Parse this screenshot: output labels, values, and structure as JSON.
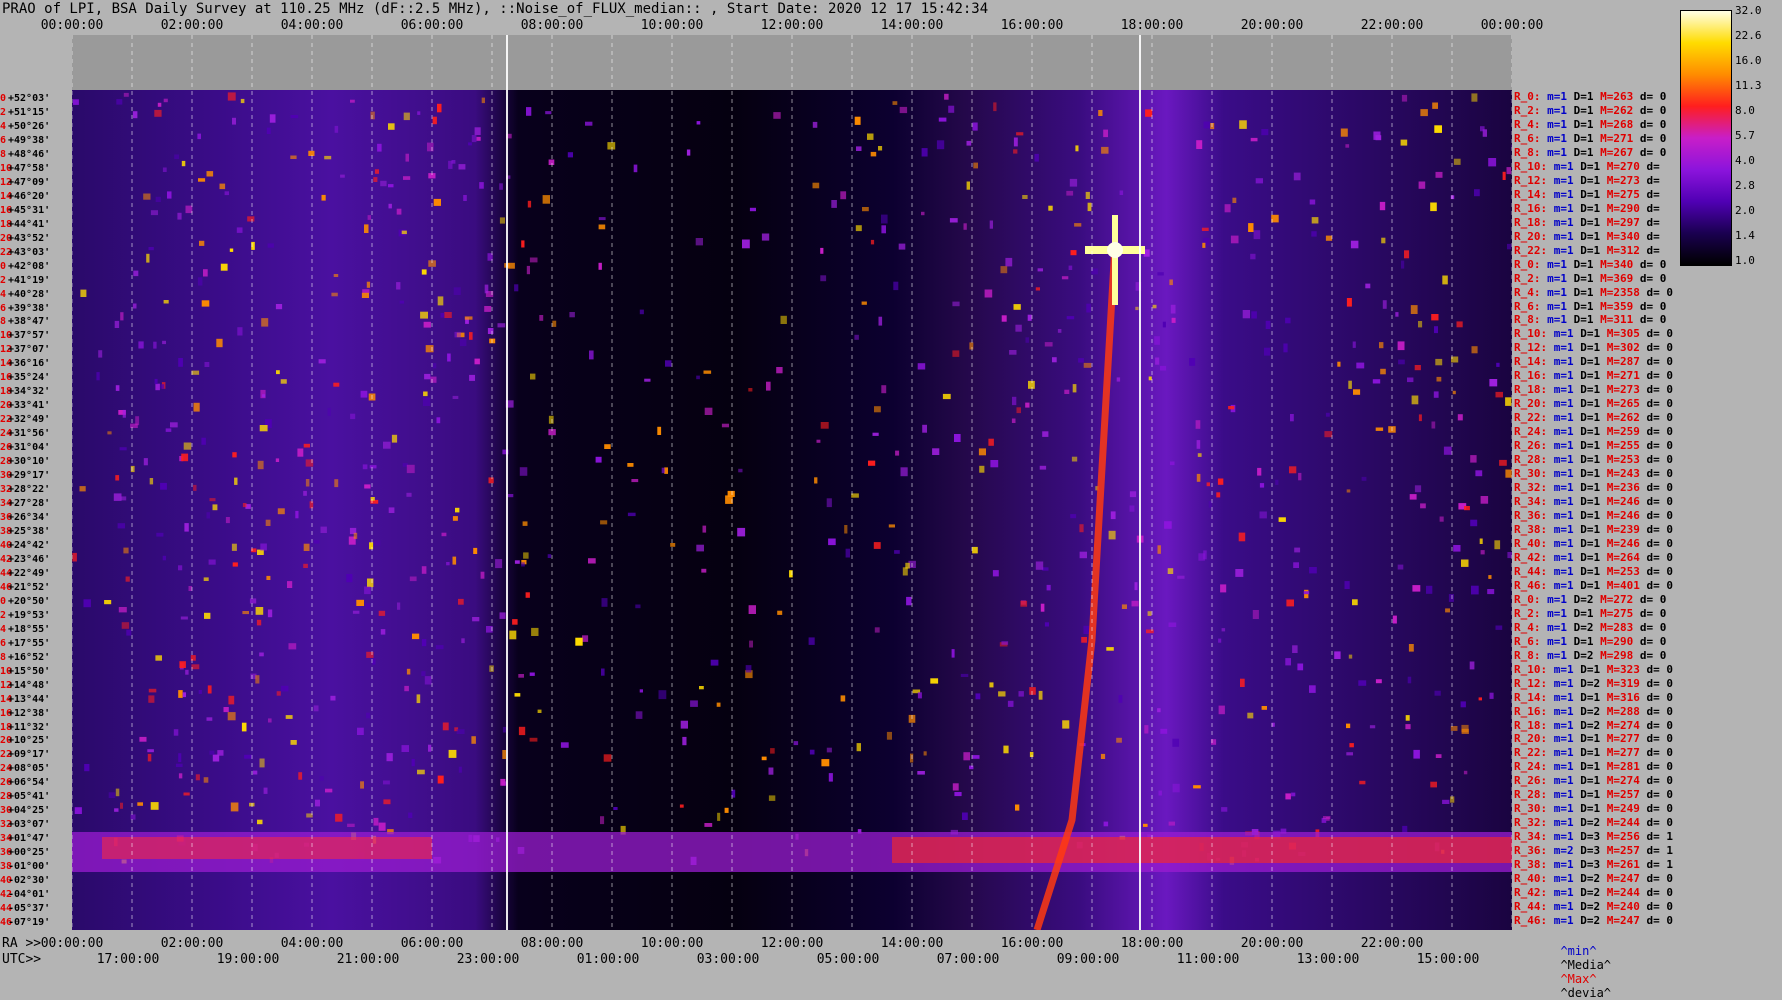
{
  "title": "PRAO of LPI, BSA Daily Survey at 110.25 MHz (dF::2.5 MHz), ::Noise_of_FLUX_median:: , Start Date: 2020 12 17 15:42:34",
  "top_axis": [
    "00:00:00",
    "02:00:00",
    "04:00:00",
    "06:00:00",
    "08:00:00",
    "10:00:00",
    "12:00:00",
    "14:00:00",
    "16:00:00",
    "18:00:00",
    "20:00:00",
    "22:00:00",
    "00:00:00"
  ],
  "ra_axis": {
    "prefix": "RA >>",
    "ticks": [
      "00:00:00",
      "02:00:00",
      "04:00:00",
      "06:00:00",
      "08:00:00",
      "10:00:00",
      "12:00:00",
      "14:00:00",
      "16:00:00",
      "18:00:00",
      "20:00:00",
      "22:00:00"
    ]
  },
  "utc_axis": {
    "prefix": "UTC>>",
    "ticks": [
      "17:00:00",
      "19:00:00",
      "21:00:00",
      "23:00:00",
      "01:00:00",
      "03:00:00",
      "05:00:00",
      "07:00:00",
      "09:00:00",
      "11:00:00",
      "13:00:00",
      "15:00:00"
    ]
  },
  "dec_labels": [
    {
      "i": "0",
      "d": "+52°03'"
    },
    {
      "i": "2",
      "d": "+51°15'"
    },
    {
      "i": "4",
      "d": "+50°26'"
    },
    {
      "i": "6",
      "d": "+49°38'"
    },
    {
      "i": "8",
      "d": "+48°46'"
    },
    {
      "i": "10",
      "d": "+47°58'"
    },
    {
      "i": "12",
      "d": "+47°09'"
    },
    {
      "i": "14",
      "d": "+46°20'"
    },
    {
      "i": "16",
      "d": "+45°31'"
    },
    {
      "i": "18",
      "d": "+44°41'"
    },
    {
      "i": "20",
      "d": "+43°52'"
    },
    {
      "i": "22",
      "d": "+43°03'"
    },
    {
      "i": "0",
      "d": "+42°08'"
    },
    {
      "i": "2",
      "d": "+41°19'"
    },
    {
      "i": "4",
      "d": "+40°28'"
    },
    {
      "i": "6",
      "d": "+39°38'"
    },
    {
      "i": "8",
      "d": "+38°47'"
    },
    {
      "i": "10",
      "d": "+37°57'"
    },
    {
      "i": "12",
      "d": "+37°07'"
    },
    {
      "i": "14",
      "d": "+36°16'"
    },
    {
      "i": "16",
      "d": "+35°24'"
    },
    {
      "i": "18",
      "d": "+34°32'"
    },
    {
      "i": "20",
      "d": "+33°41'"
    },
    {
      "i": "22",
      "d": "+32°49'"
    },
    {
      "i": "24",
      "d": "+31°56'"
    },
    {
      "i": "26",
      "d": "+31°04'"
    },
    {
      "i": "28",
      "d": "+30°10'"
    },
    {
      "i": "30",
      "d": "+29°17'"
    },
    {
      "i": "32",
      "d": "+28°22'"
    },
    {
      "i": "34",
      "d": "+27°28'"
    },
    {
      "i": "36",
      "d": "+26°34'"
    },
    {
      "i": "38",
      "d": "+25°38'"
    },
    {
      "i": "40",
      "d": "+24°42'"
    },
    {
      "i": "42",
      "d": "+23°46'"
    },
    {
      "i": "44",
      "d": "+22°49'"
    },
    {
      "i": "46",
      "d": "+21°52'"
    },
    {
      "i": "0",
      "d": "+20°50'"
    },
    {
      "i": "2",
      "d": "+19°53'"
    },
    {
      "i": "4",
      "d": "+18°55'"
    },
    {
      "i": "6",
      "d": "+17°55'"
    },
    {
      "i": "8",
      "d": "+16°52'"
    },
    {
      "i": "10",
      "d": "+15°50'"
    },
    {
      "i": "12",
      "d": "+14°48'"
    },
    {
      "i": "14",
      "d": "+13°44'"
    },
    {
      "i": "16",
      "d": "+12°38'"
    },
    {
      "i": "18",
      "d": "+11°32'"
    },
    {
      "i": "20",
      "d": "+10°25'"
    },
    {
      "i": "22",
      "d": "+09°17'"
    },
    {
      "i": "24",
      "d": "+08°05'"
    },
    {
      "i": "26",
      "d": "+06°54'"
    },
    {
      "i": "28",
      "d": "+05°41'"
    },
    {
      "i": "30",
      "d": "+04°25'"
    },
    {
      "i": "32",
      "d": "+03°07'"
    },
    {
      "i": "34",
      "d": "+01°47'"
    },
    {
      "i": "36",
      "d": "+00°25'"
    },
    {
      "i": "38",
      "d": "-01°00'"
    },
    {
      "i": "40",
      "d": "-02°30'"
    },
    {
      "i": "42",
      "d": "-04°01'"
    },
    {
      "i": "44",
      "d": "-05°37'"
    },
    {
      "i": "46",
      "d": "-07°19'"
    }
  ],
  "legend_rows": [
    {
      "r": "R_0:",
      "m": "m=1",
      "D": "D=1",
      "M": "M=263",
      "d": "d= 0"
    },
    {
      "r": "R_2:",
      "m": "m=1",
      "D": "D=1",
      "M": "M=262",
      "d": "d= 0"
    },
    {
      "r": "R_4:",
      "m": "m=1",
      "D": "D=1",
      "M": "M=268",
      "d": "d= 0"
    },
    {
      "r": "R_6:",
      "m": "m=1",
      "D": "D=1",
      "M": "M=271",
      "d": "d= 0"
    },
    {
      "r": "R_8:",
      "m": "m=1",
      "D": "D=1",
      "M": "M=267",
      "d": "d= 0"
    },
    {
      "r": "R_10:",
      "m": "m=1",
      "D": "D=1",
      "M": "M=270",
      "d": "d="
    },
    {
      "r": "R_12:",
      "m": "m=1",
      "D": "D=1",
      "M": "M=273",
      "d": "d="
    },
    {
      "r": "R_14:",
      "m": "m=1",
      "D": "D=1",
      "M": "M=275",
      "d": "d="
    },
    {
      "r": "R_16:",
      "m": "m=1",
      "D": "D=1",
      "M": "M=290",
      "d": "d="
    },
    {
      "r": "R_18:",
      "m": "m=1",
      "D": "D=1",
      "M": "M=297",
      "d": "d="
    },
    {
      "r": "R_20:",
      "m": "m=1",
      "D": "D=1",
      "M": "M=340",
      "d": "d="
    },
    {
      "r": "R_22:",
      "m": "m=1",
      "D": "D=1",
      "M": "M=312",
      "d": "d="
    },
    {
      "r": "R_0:",
      "m": "m=1",
      "D": "D=1",
      "M": "M=340",
      "d": "d= 0"
    },
    {
      "r": "R_2:",
      "m": "m=1",
      "D": "D=1",
      "M": "M=369",
      "d": "d= 0"
    },
    {
      "r": "R_4:",
      "m": "m=1",
      "D": "D=1",
      "M": "M=2358",
      "d": "d= 0"
    },
    {
      "r": "R_6:",
      "m": "m=1",
      "D": "D=1",
      "M": "M=359",
      "d": "d= 0"
    },
    {
      "r": "R_8:",
      "m": "m=1",
      "D": "D=1",
      "M": "M=311",
      "d": "d= 0"
    },
    {
      "r": "R_10:",
      "m": "m=1",
      "D": "D=1",
      "M": "M=305",
      "d": "d= 0"
    },
    {
      "r": "R_12:",
      "m": "m=1",
      "D": "D=1",
      "M": "M=302",
      "d": "d= 0"
    },
    {
      "r": "R_14:",
      "m": "m=1",
      "D": "D=1",
      "M": "M=287",
      "d": "d= 0"
    },
    {
      "r": "R_16:",
      "m": "m=1",
      "D": "D=1",
      "M": "M=271",
      "d": "d= 0"
    },
    {
      "r": "R_18:",
      "m": "m=1",
      "D": "D=1",
      "M": "M=273",
      "d": "d= 0"
    },
    {
      "r": "R_20:",
      "m": "m=1",
      "D": "D=1",
      "M": "M=265",
      "d": "d= 0"
    },
    {
      "r": "R_22:",
      "m": "m=1",
      "D": "D=1",
      "M": "M=262",
      "d": "d= 0"
    },
    {
      "r": "R_24:",
      "m": "m=1",
      "D": "D=1",
      "M": "M=259",
      "d": "d= 0"
    },
    {
      "r": "R_26:",
      "m": "m=1",
      "D": "D=1",
      "M": "M=255",
      "d": "d= 0"
    },
    {
      "r": "R_28:",
      "m": "m=1",
      "D": "D=1",
      "M": "M=253",
      "d": "d= 0"
    },
    {
      "r": "R_30:",
      "m": "m=1",
      "D": "D=1",
      "M": "M=243",
      "d": "d= 0"
    },
    {
      "r": "R_32:",
      "m": "m=1",
      "D": "D=1",
      "M": "M=236",
      "d": "d= 0"
    },
    {
      "r": "R_34:",
      "m": "m=1",
      "D": "D=1",
      "M": "M=246",
      "d": "d= 0"
    },
    {
      "r": "R_36:",
      "m": "m=1",
      "D": "D=1",
      "M": "M=246",
      "d": "d= 0"
    },
    {
      "r": "R_38:",
      "m": "m=1",
      "D": "D=1",
      "M": "M=239",
      "d": "d= 0"
    },
    {
      "r": "R_40:",
      "m": "m=1",
      "D": "D=1",
      "M": "M=246",
      "d": "d= 0"
    },
    {
      "r": "R_42:",
      "m": "m=1",
      "D": "D=1",
      "M": "M=264",
      "d": "d= 0"
    },
    {
      "r": "R_44:",
      "m": "m=1",
      "D": "D=1",
      "M": "M=253",
      "d": "d= 0"
    },
    {
      "r": "R_46:",
      "m": "m=1",
      "D": "D=1",
      "M": "M=401",
      "d": "d= 0"
    },
    {
      "r": "R_0:",
      "m": "m=1",
      "D": "D=2",
      "M": "M=272",
      "d": "d= 0"
    },
    {
      "r": "R_2:",
      "m": "m=1",
      "D": "D=1",
      "M": "M=275",
      "d": "d= 0"
    },
    {
      "r": "R_4:",
      "m": "m=1",
      "D": "D=2",
      "M": "M=283",
      "d": "d= 0"
    },
    {
      "r": "R_6:",
      "m": "m=1",
      "D": "D=1",
      "M": "M=290",
      "d": "d= 0"
    },
    {
      "r": "R_8:",
      "m": "m=1",
      "D": "D=2",
      "M": "M=298",
      "d": "d= 0"
    },
    {
      "r": "R_10:",
      "m": "m=1",
      "D": "D=1",
      "M": "M=323",
      "d": "d= 0"
    },
    {
      "r": "R_12:",
      "m": "m=1",
      "D": "D=2",
      "M": "M=319",
      "d": "d= 0"
    },
    {
      "r": "R_14:",
      "m": "m=1",
      "D": "D=1",
      "M": "M=316",
      "d": "d= 0"
    },
    {
      "r": "R_16:",
      "m": "m=1",
      "D": "D=2",
      "M": "M=288",
      "d": "d= 0"
    },
    {
      "r": "R_18:",
      "m": "m=1",
      "D": "D=2",
      "M": "M=274",
      "d": "d= 0"
    },
    {
      "r": "R_20:",
      "m": "m=1",
      "D": "D=1",
      "M": "M=277",
      "d": "d= 0"
    },
    {
      "r": "R_22:",
      "m": "m=1",
      "D": "D=1",
      "M": "M=277",
      "d": "d= 0"
    },
    {
      "r": "R_24:",
      "m": "m=1",
      "D": "D=1",
      "M": "M=281",
      "d": "d= 0"
    },
    {
      "r": "R_26:",
      "m": "m=1",
      "D": "D=1",
      "M": "M=274",
      "d": "d= 0"
    },
    {
      "r": "R_28:",
      "m": "m=1",
      "D": "D=1",
      "M": "M=257",
      "d": "d= 0"
    },
    {
      "r": "R_30:",
      "m": "m=1",
      "D": "D=1",
      "M": "M=249",
      "d": "d= 0"
    },
    {
      "r": "R_32:",
      "m": "m=1",
      "D": "D=2",
      "M": "M=244",
      "d": "d= 0"
    },
    {
      "r": "R_34:",
      "m": "m=1",
      "D": "D=3",
      "M": "M=256",
      "d": "d= 1"
    },
    {
      "r": "R_36:",
      "m": "m=2",
      "D": "D=3",
      "M": "M=257",
      "d": "d= 1"
    },
    {
      "r": "R_38:",
      "m": "m=1",
      "D": "D=3",
      "M": "M=261",
      "d": "d= 1"
    },
    {
      "r": "R_40:",
      "m": "m=1",
      "D": "D=2",
      "M": "M=247",
      "d": "d= 0"
    },
    {
      "r": "R_42:",
      "m": "m=1",
      "D": "D=2",
      "M": "M=244",
      "d": "d= 0"
    },
    {
      "r": "R_44:",
      "m": "m=1",
      "D": "D=2",
      "M": "M=240",
      "d": "d= 0"
    },
    {
      "r": "R_46:",
      "m": "m=1",
      "D": "D=2",
      "M": "M=247",
      "d": "d= 0"
    }
  ],
  "legend_footer": {
    "min": "^min^",
    "median": "^Media^",
    "max": "^Max^",
    "devia": "^devia^"
  },
  "colorbar": {
    "ticks": [
      "32.0",
      "22.6",
      "16.0",
      "11.3",
      "8.0",
      "5.7",
      "4.0",
      "2.8",
      "2.0",
      "1.4",
      "1.0"
    ]
  },
  "chart_data": {
    "type": "heatmap",
    "title": "PRAO of LPI, BSA Daily Survey at 110.25 MHz (dF::2.5 MHz), ::Noise_of_FLUX_median:: , Start Date: 2020 12 17 15:42:34",
    "x_axis_ra_hours": [
      0,
      24
    ],
    "y_axis": "declination rows (60 beams, +52°03' to -07°19')",
    "colorscale": [
      "#000000",
      "#1a0050",
      "#5000b4",
      "#8c14dc",
      "#c81ec8",
      "#ff1e1e",
      "#ff8c00",
      "#ffdc00",
      "#ffffe6"
    ],
    "colorbar_range": [
      1.0,
      32.0
    ],
    "colorbar_scale": "log",
    "features": [
      {
        "name": "bright-source-cross",
        "ra_h": 20.0,
        "dec": "+41°19'",
        "value": 32.0
      },
      {
        "name": "galactic-plane-band",
        "ra_h_range": [
          0,
          24
        ],
        "dec_range": [
          "+01°47'",
          "-02°30'"
        ]
      },
      {
        "name": "diagonal-trail",
        "ra_h_range": [
          18.5,
          20.0
        ],
        "dec_range": [
          "-07°19'",
          "+41°19'"
        ]
      }
    ]
  }
}
